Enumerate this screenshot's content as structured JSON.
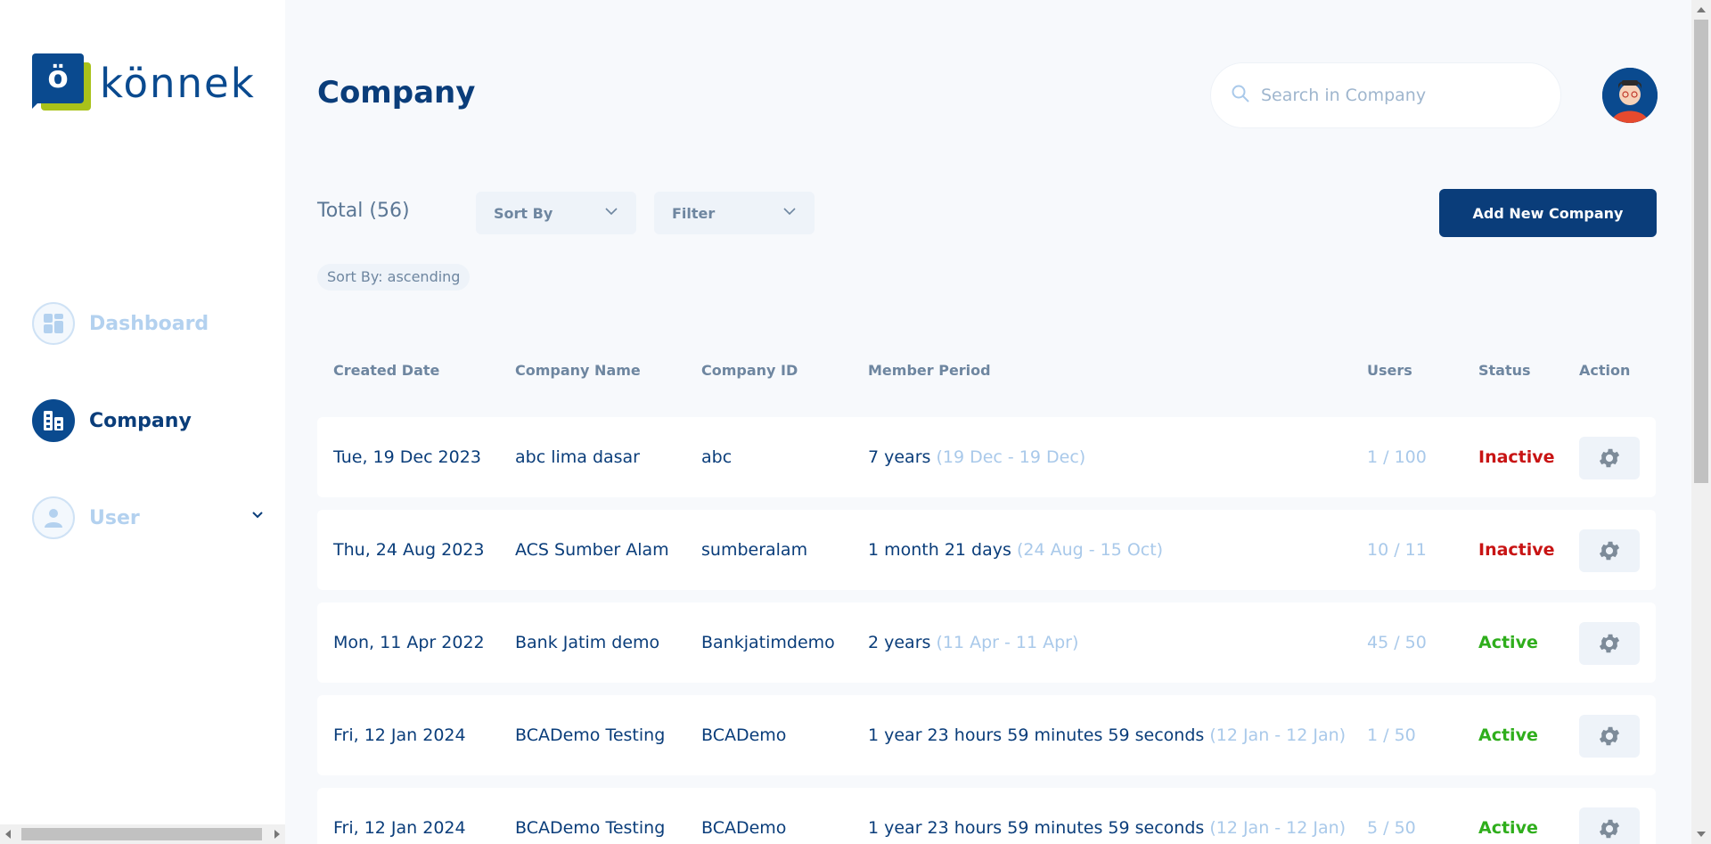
{
  "brand": {
    "mark": "ö",
    "name": "könnek"
  },
  "sidebar": {
    "items": [
      {
        "label": "Dashboard",
        "icon": "dashboard-icon",
        "active": false
      },
      {
        "label": "Company",
        "icon": "company-icon",
        "active": true
      },
      {
        "label": "User",
        "icon": "user-icon",
        "active": false,
        "expandable": true
      }
    ]
  },
  "header": {
    "title": "Company",
    "search_placeholder": "Search in Company"
  },
  "toolbar": {
    "total": "Total (56)",
    "sort_label": "Sort By",
    "filter_label": "Filter",
    "add_label": "Add New Company",
    "sort_chip": "Sort By: ascending"
  },
  "table": {
    "columns": [
      "Created Date",
      "Company Name",
      "Company ID",
      "Member Period",
      "Users",
      "Status",
      "Action"
    ],
    "rows": [
      {
        "date": "Tue, 19 Dec 2023",
        "name": "abc lima dasar",
        "id": "abc",
        "period": "7 years",
        "range": "(19 Dec - 19 Dec)",
        "users": "1 / 100",
        "status": "Inactive"
      },
      {
        "date": "Thu, 24 Aug 2023",
        "name": "ACS Sumber Alam",
        "id": "sumberalam",
        "period": "1 month 21 days",
        "range": "(24 Aug - 15 Oct)",
        "users": "10 / 11",
        "status": "Inactive"
      },
      {
        "date": "Mon, 11 Apr 2022",
        "name": "Bank Jatim demo",
        "id": "Bankjatimdemo",
        "period": "2 years",
        "range": "(11 Apr - 11 Apr)",
        "users": "45 / 50",
        "status": "Active"
      },
      {
        "date": "Fri, 12 Jan 2024",
        "name": "BCADemo Testing",
        "id": "BCADemo",
        "period": "1 year 23 hours 59 minutes 59 seconds",
        "range": "(12 Jan - 12 Jan)",
        "users": "1 / 50",
        "status": "Active"
      },
      {
        "date": "Fri, 12 Jan 2024",
        "name": "BCADemo Testing",
        "id": "BCADemo",
        "period": "1 year 23 hours 59 minutes 59 seconds",
        "range": "(12 Jan - 12 Jan)",
        "users": "5 / 50",
        "status": "Active"
      }
    ]
  },
  "colors": {
    "primary": "#0a3d7a",
    "accent_green": "#a9c21a",
    "active": "#2fae1c",
    "inactive": "#c81414",
    "muted": "#a9c9ea"
  }
}
